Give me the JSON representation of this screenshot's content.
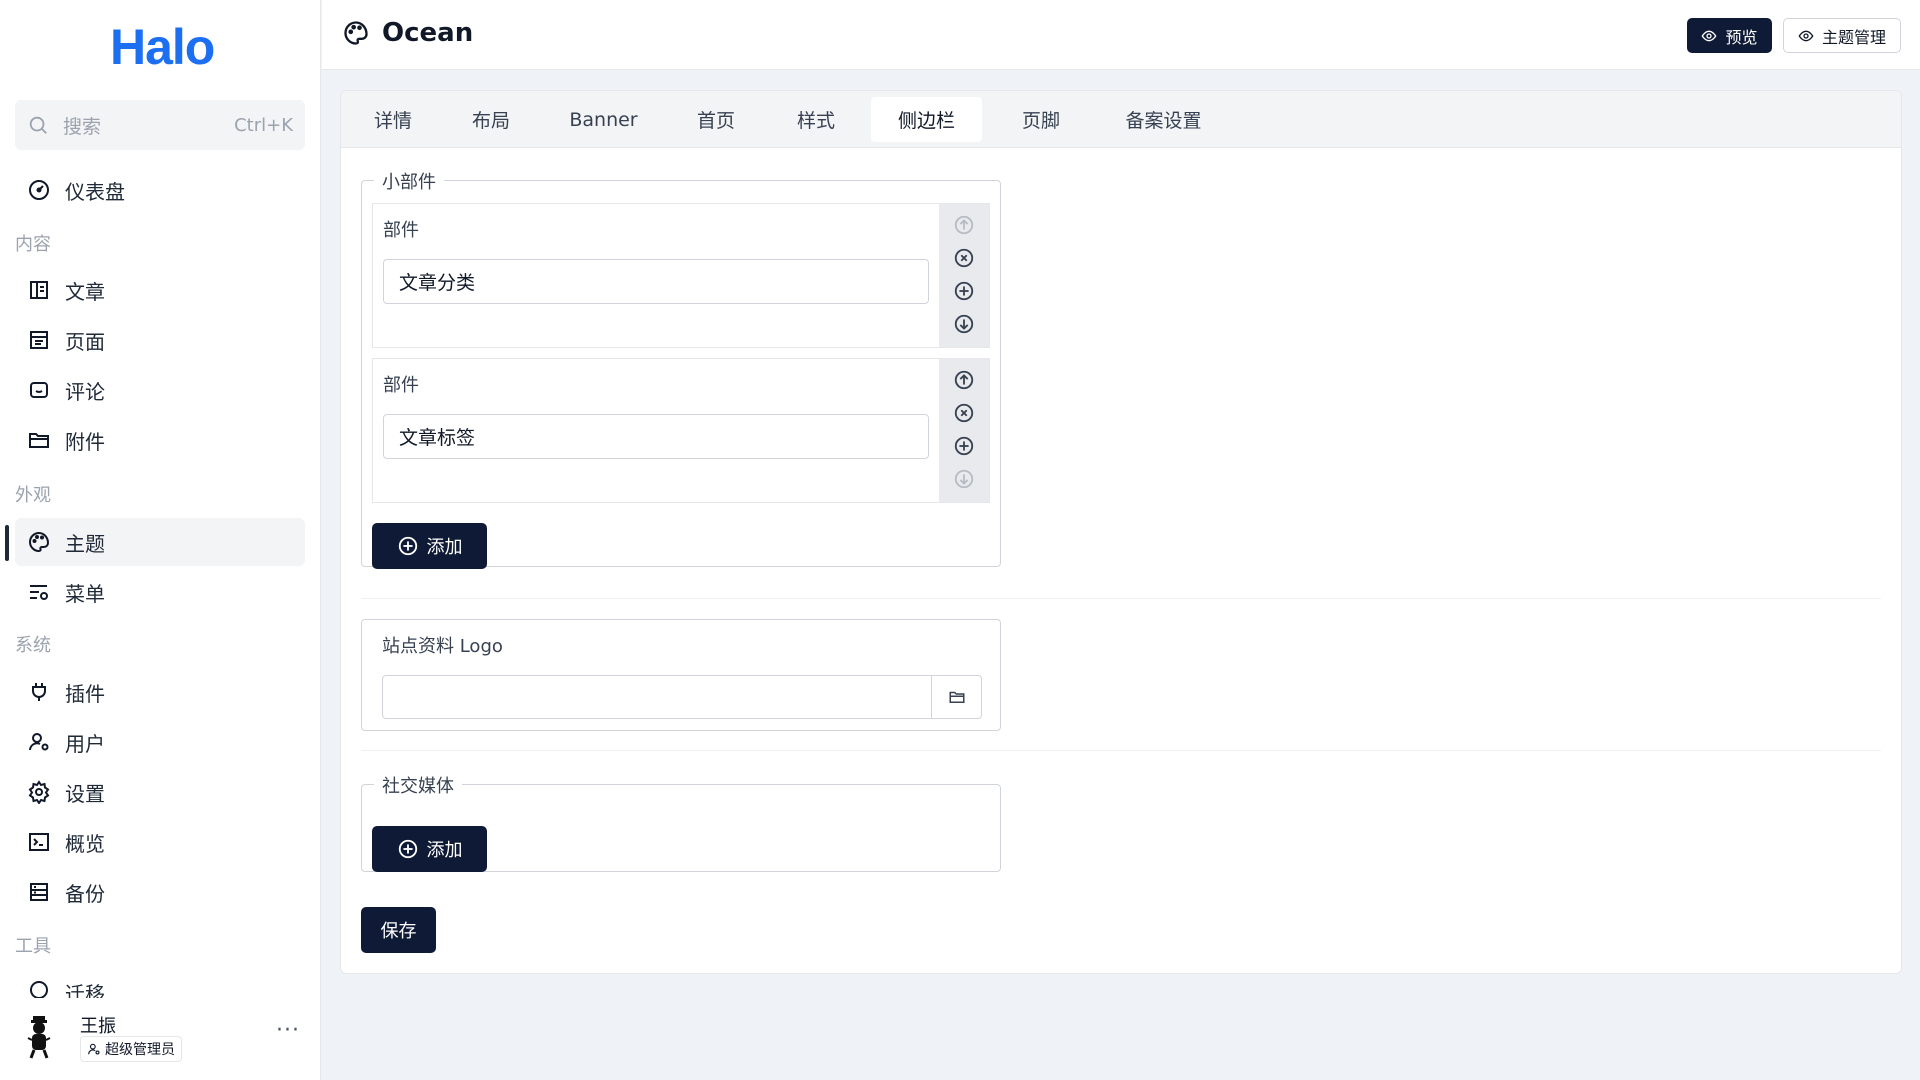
{
  "brand": {
    "logo_text": "Halo"
  },
  "search": {
    "placeholder": "搜索",
    "shortcut": "Ctrl+K"
  },
  "nav": {
    "dashboard": "仪表盘",
    "group_content": "内容",
    "posts": "文章",
    "pages": "页面",
    "comments": "评论",
    "attachments": "附件",
    "group_appearance": "外观",
    "themes": "主题",
    "menus": "菜单",
    "group_system": "系统",
    "plugins": "插件",
    "users": "用户",
    "settings": "设置",
    "overview": "概览",
    "backup": "备份",
    "group_tools": "工具",
    "migrate_partial": "迁移"
  },
  "user": {
    "name": "王振",
    "role": "超级管理员"
  },
  "header": {
    "title": "Ocean",
    "preview_label": "预览",
    "theme_manage_label": "主题管理"
  },
  "tabs": [
    "详情",
    "布局",
    "Banner",
    "首页",
    "样式",
    "侧边栏",
    "页脚",
    "备案设置"
  ],
  "active_tab": "侧边栏",
  "widgets": {
    "legend": "小部件",
    "items": [
      {
        "label": "部件",
        "value": "文章分类"
      },
      {
        "label": "部件",
        "value": "文章标签"
      }
    ],
    "add_label": "添加"
  },
  "site_logo": {
    "label": "站点资料 Logo",
    "value": ""
  },
  "social": {
    "legend": "社交媒体",
    "add_label": "添加"
  },
  "save_label": "保存"
}
